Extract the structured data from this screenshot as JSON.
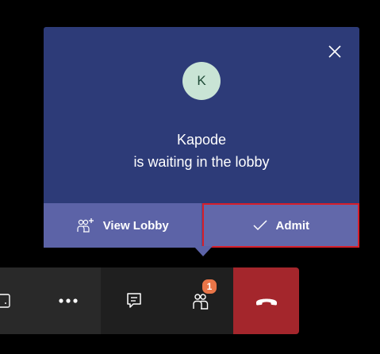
{
  "lobby_popup": {
    "avatar_initial": "K",
    "participant_name": "Kapode",
    "waiting_text": "is waiting in the lobby",
    "view_lobby_label": "View Lobby",
    "admit_label": "Admit",
    "icons": {
      "close": "close-icon",
      "view_lobby": "people-add-icon",
      "admit": "checkmark-icon"
    }
  },
  "call_controls": {
    "buttons": [
      {
        "name": "share-screen-button",
        "icon": "share-tray-icon"
      },
      {
        "name": "more-actions-button",
        "icon": "ellipsis-icon"
      },
      {
        "name": "chat-button",
        "icon": "chat-icon"
      },
      {
        "name": "participants-button",
        "icon": "people-icon",
        "badge": "1"
      },
      {
        "name": "hang-up-button",
        "icon": "hang-up-icon"
      }
    ]
  },
  "colors": {
    "popup_bg": "#2d3b78",
    "action_bg": "#5c63a7",
    "hangup_bg": "#a4262c",
    "badge_bg": "#e97548",
    "highlight_outline": "#d71f2b"
  }
}
